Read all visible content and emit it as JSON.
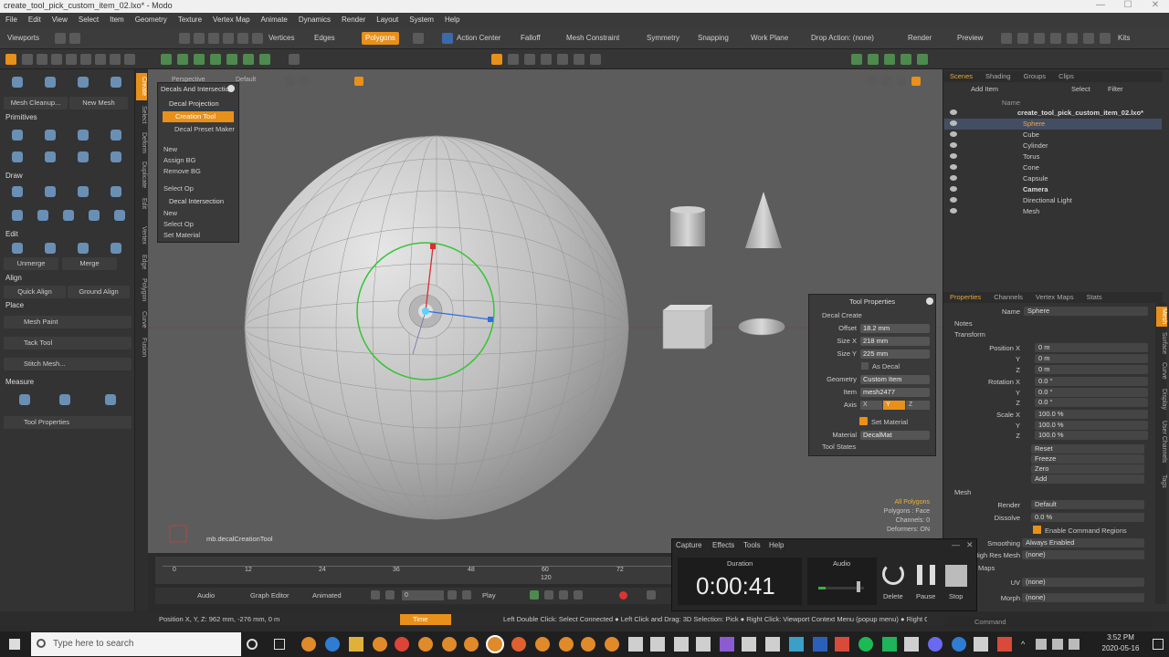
{
  "window": {
    "title": "create_tool_pick_custom_item_02.lxo* - Modo"
  },
  "menu": [
    "File",
    "Edit",
    "View",
    "Select",
    "Item",
    "Geometry",
    "Texture",
    "Vertex Map",
    "Animate",
    "Dynamics",
    "Render",
    "Layout",
    "System",
    "Help"
  ],
  "toolbar": {
    "viewports": "Viewports",
    "vertices": "Vertices",
    "edges": "Edges",
    "polygons": "Polygons",
    "action_center": "Action Center",
    "falloff": "Falloff",
    "mesh_constraint": "Mesh Constraint",
    "symmetry": "Symmetry",
    "snapping": "Snapping",
    "work_plane": "Work Plane",
    "drop_action": "Drop Action: (none)",
    "render": "Render",
    "preview": "Preview",
    "kits": "Kits"
  },
  "left": {
    "mesh_cleanup": "Mesh Cleanup...",
    "new_mesh": "New Mesh",
    "primitives": "Primitives",
    "draw": "Draw",
    "edit": "Edit",
    "unmerge": "Unmerge",
    "merge": "Merge",
    "align": "Align",
    "quick_align": "Quick Align",
    "ground_align": "Ground Align",
    "place": "Place",
    "mesh_paint": "Mesh Paint",
    "tack_tool": "Tack Tool",
    "stitch_mesh": "Stitch Mesh...",
    "measure": "Measure",
    "tool_properties": "Tool Properties",
    "vtabs": [
      "Create",
      "Select",
      "Deform",
      "Duplicate",
      "Edit",
      "Vertex",
      "Edge",
      "Polygon",
      "Curve",
      "Fusion"
    ]
  },
  "viewport": {
    "tab_perspective": "Perspective",
    "tab_default": "Default",
    "cmd_label": "mb.decalCreationTool",
    "info": [
      "All Polygons",
      "Polygons : Face",
      "Channels: 0",
      "Deformers: ON"
    ]
  },
  "decal_panel": {
    "title": "Decals And Intersection",
    "decal_projection": "Decal Projection",
    "creation_tool": "Creation Tool",
    "decal_preset_maker": "Decal Preset Maker",
    "new": "New",
    "assign_bg": "Assign BG",
    "remove_bg": "Remove BG",
    "select_op": "Select Op",
    "decal_intersection": "Decal Intersection",
    "new2": "New",
    "select_op2": "Select Op",
    "set_material": "Set Material"
  },
  "tool_props": {
    "title": "Tool Properties",
    "decal_create": "Decal Create",
    "offset_label": "Offset",
    "offset": "18.2 mm",
    "sizex_label": "Size X",
    "sizex": "218 mm",
    "sizey_label": "Size Y",
    "sizey": "225 mm",
    "as_decal": "As Decal",
    "geometry_label": "Geometry",
    "geometry": "Custom Item",
    "item_label": "Item",
    "item": "mesh2477",
    "axis_label": "Axis",
    "axis_x": "X",
    "axis_y": "Y",
    "axis_z": "Z",
    "set_material": "Set Material",
    "material_label": "Material",
    "material": "DecalMat",
    "tool_states": "Tool States"
  },
  "right": {
    "tabs": [
      "Scenes",
      "Shading",
      "Groups",
      "Clips"
    ],
    "add_item": "Add Item",
    "select": "Select",
    "filter": "Filter",
    "name_col": "Name",
    "scene_name": "create_tool_pick_custom_item_02.lxo*",
    "items": [
      "Sphere",
      "Cube",
      "Cylinder",
      "Torus",
      "Cone",
      "Capsule",
      "Camera",
      "Directional Light",
      "Mesh"
    ],
    "prop_tabs": [
      "Properties",
      "Channels",
      "Vertex Maps",
      "Stats"
    ],
    "name_label": "Name",
    "name_value": "Sphere",
    "notes": "Notes",
    "transform": "Transform",
    "position_x_label": "Position X",
    "position_x": "0 m",
    "y_label": "Y",
    "position_y": "0 m",
    "z_label": "Z",
    "position_z": "0 m",
    "rotation_x_label": "Rotation X",
    "rotation_x": "0.0 °",
    "rotation_y": "0.0 °",
    "rotation_z": "0.0 °",
    "scale_x_label": "Scale X",
    "scale_x": "100.0 %",
    "scale_y": "100.0 %",
    "scale_z": "100.0 %",
    "reset": "Reset",
    "freeze": "Freeze",
    "zero": "Zero",
    "add": "Add",
    "mesh": "Mesh",
    "render_label": "Render",
    "render_value": "Default",
    "dissolve_label": "Dissolve",
    "dissolve_value": "0.0 %",
    "enable_cmd_regions": "Enable Command Regions",
    "smoothing_label": "Smoothing",
    "smoothing_value": "Always Enabled",
    "high_res_label": "High Res Mesh",
    "high_res_value": "(none)",
    "maps": "Maps",
    "uv_label": "UV",
    "uv_value": "(none)",
    "morph_label": "Morph",
    "morph_value": "(none)",
    "vtabs": [
      "Mesh",
      "Surface",
      "Curve",
      "Display",
      "User Channels",
      "Tags"
    ],
    "command": "Command"
  },
  "timeline": {
    "ticks": [
      "0",
      "12",
      "24",
      "36",
      "48",
      "60",
      "72"
    ],
    "tick_120": "120",
    "audio": "Audio",
    "graph_editor": "Graph Editor",
    "animated": "Animated",
    "frame": "0",
    "play": "Play"
  },
  "status": {
    "position": "Position X, Y, Z:  962 mm, -276 mm, 0 m",
    "time": "Time",
    "hint": "Left Double Click: Select Connected ● Left Click and Drag: 3D Selection: Pick ● Right Click: Viewport Context Menu (popup menu) ● Right Click"
  },
  "recorder": {
    "menu": [
      "Capture",
      "Effects",
      "Tools",
      "Help"
    ],
    "duration_label": "Duration",
    "duration": "0:00:41",
    "audio_label": "Audio",
    "delete": "Delete",
    "pause": "Pause",
    "stop": "Stop"
  },
  "taskbar": {
    "search": "Type here to search",
    "time": "3:52 PM",
    "date": "2020-05-16"
  }
}
